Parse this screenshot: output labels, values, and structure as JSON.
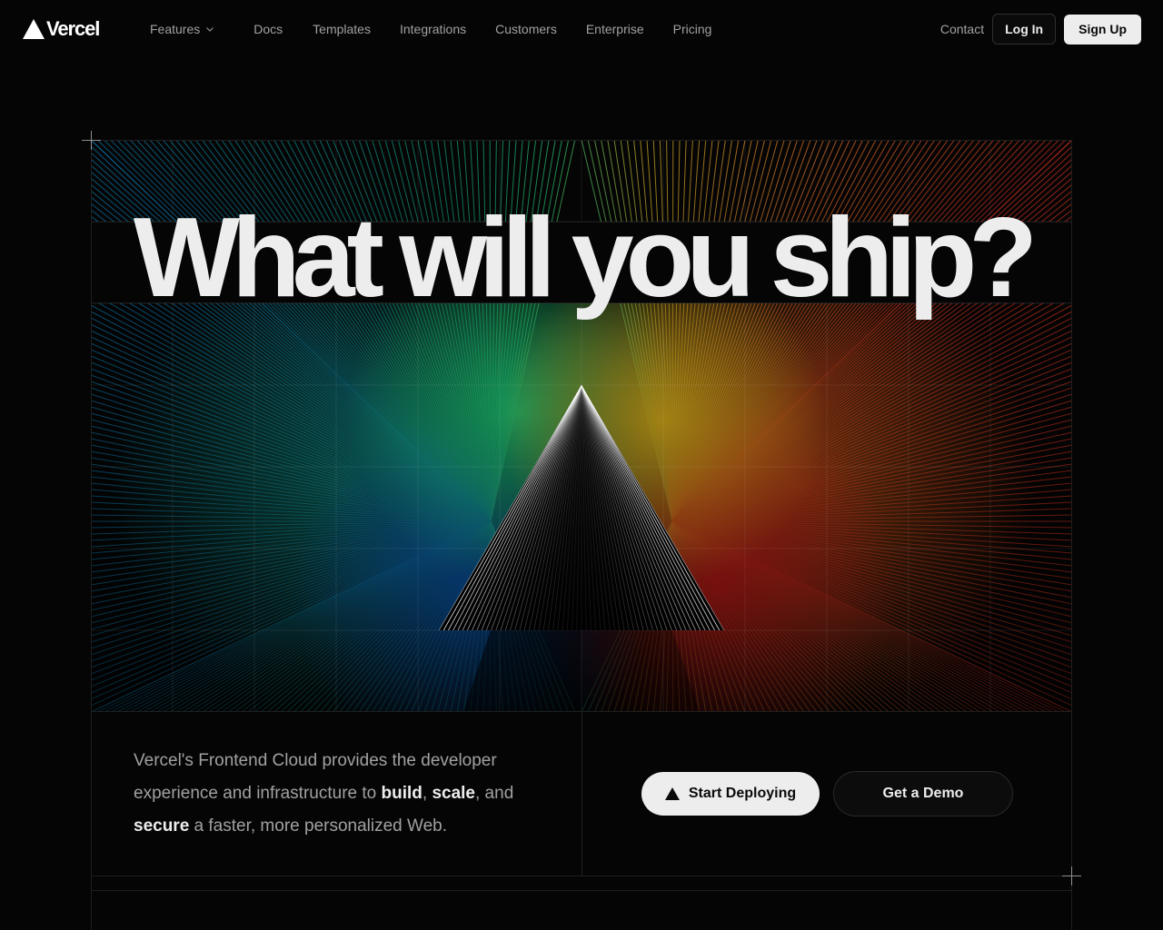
{
  "brand": {
    "name": "Vercel",
    "logo_icon": "vercel-triangle-icon"
  },
  "nav": {
    "items": [
      {
        "label": "Features",
        "has_dropdown": true,
        "icon": "chevron-down-icon"
      },
      {
        "label": "Docs"
      },
      {
        "label": "Templates"
      },
      {
        "label": "Integrations"
      },
      {
        "label": "Customers"
      },
      {
        "label": "Enterprise"
      },
      {
        "label": "Pricing"
      }
    ],
    "contact_label": "Contact",
    "login_label": "Log In",
    "signup_label": "Sign Up"
  },
  "hero": {
    "headline": "What will you ship?",
    "tagline_parts": {
      "p1": "Vercel's Frontend Cloud provides the developer experience and infrastructure to ",
      "b1": "build",
      "p2": ", ",
      "b2": "scale",
      "p3": ", and ",
      "b3": "secure",
      "p4": " a faster, more personalized Web."
    },
    "primary_cta": {
      "label": "Start Deploying",
      "icon": "vercel-triangle-icon"
    },
    "secondary_cta": {
      "label": "Get a Demo"
    }
  },
  "colors": {
    "background": "#050505",
    "text_primary": "#ededed",
    "text_muted": "#a1a1a1",
    "spectrum": [
      "#0b6fd6",
      "#12b8a0",
      "#1fd17a",
      "#e3b51a",
      "#f06a1a",
      "#d11a1a"
    ]
  }
}
